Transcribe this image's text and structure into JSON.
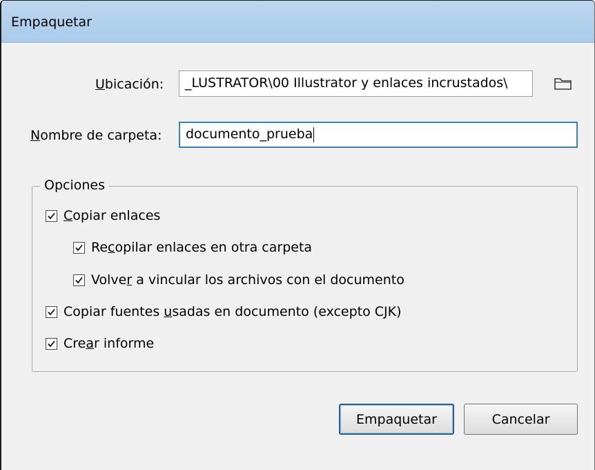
{
  "window": {
    "title": "Empaquetar"
  },
  "location": {
    "label_accel": "U",
    "label_rest": "bicación:",
    "value": "_LUSTRATOR\\00 Illustrator y enlaces incrustados\\",
    "browse_icon": "folder-icon"
  },
  "folder_name": {
    "label_accel": "N",
    "label_rest": "ombre de carpeta:",
    "value": "documento_prueba"
  },
  "options": {
    "legend": "Opciones",
    "items": [
      {
        "before": "",
        "accel": "C",
        "after": "opiar enlaces",
        "checked": true
      },
      {
        "before": "Re",
        "accel": "c",
        "after": "opilar enlaces en otra carpeta",
        "checked": true
      },
      {
        "before": "Volve",
        "accel": "r",
        "after": " a vincular los archivos con el documento",
        "checked": true
      },
      {
        "before": "Copiar fuentes ",
        "accel": "u",
        "after": "sadas en documento (excepto CJK)",
        "checked": true
      },
      {
        "before": "Cre",
        "accel": "a",
        "after": "r informe",
        "checked": true
      }
    ]
  },
  "buttons": {
    "ok": "Empaquetar",
    "cancel": "Cancelar"
  }
}
